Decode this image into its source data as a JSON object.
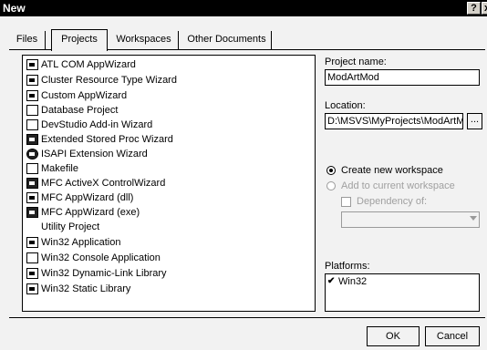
{
  "window": {
    "title": "New",
    "help_glyph": "?",
    "close_glyph": "x"
  },
  "tabs": [
    {
      "label": "Files",
      "active": false
    },
    {
      "label": "Projects",
      "active": true
    },
    {
      "label": "Workspaces",
      "active": false
    },
    {
      "label": "Other Documents",
      "active": false
    }
  ],
  "project_types": [
    {
      "label": "ATL COM AppWizard",
      "icon": "atl-com-icon"
    },
    {
      "label": "Cluster Resource Type Wizard",
      "icon": "cluster-wizard-icon"
    },
    {
      "label": "Custom AppWizard",
      "icon": "custom-wizard-icon"
    },
    {
      "label": "Database Project",
      "icon": "database-icon"
    },
    {
      "label": "DevStudio Add-in Wizard",
      "icon": "add-in-icon"
    },
    {
      "label": "Extended Stored Proc Wizard",
      "icon": "stored-proc-icon"
    },
    {
      "label": "ISAPI Extension Wizard",
      "icon": "globe-icon"
    },
    {
      "label": "Makefile",
      "icon": "makefile-icon"
    },
    {
      "label": "MFC ActiveX ControlWizard",
      "icon": "activex-icon"
    },
    {
      "label": "MFC AppWizard (dll)",
      "icon": "mfc-dll-icon"
    },
    {
      "label": "MFC AppWizard (exe)",
      "icon": "mfc-exe-icon"
    },
    {
      "label": "Utility Project",
      "icon": "utility-icon"
    },
    {
      "label": "Win32 Application",
      "icon": "win32-app-icon"
    },
    {
      "label": "Win32 Console Application",
      "icon": "console-icon"
    },
    {
      "label": "Win32 Dynamic-Link Library",
      "icon": "dll-icon"
    },
    {
      "label": "Win32 Static Library",
      "icon": "static-lib-icon"
    }
  ],
  "project_name": {
    "label": "Project name:",
    "value": "ModArtMod"
  },
  "location": {
    "label": "Location:",
    "value": "D:\\MSVS\\MyProjects\\ModArtM",
    "browse_label": "..."
  },
  "workspace_options": {
    "create_new": {
      "label": "Create new workspace",
      "checked": true
    },
    "add_current": {
      "label": "Add to current workspace",
      "checked": false
    },
    "dependency": {
      "label": "Dependency of:",
      "checked": false
    },
    "dependency_value": ""
  },
  "platforms": {
    "label": "Platforms:",
    "items": [
      {
        "label": "Win32",
        "checked": true
      }
    ]
  },
  "buttons": {
    "ok": "OK",
    "cancel": "Cancel"
  }
}
